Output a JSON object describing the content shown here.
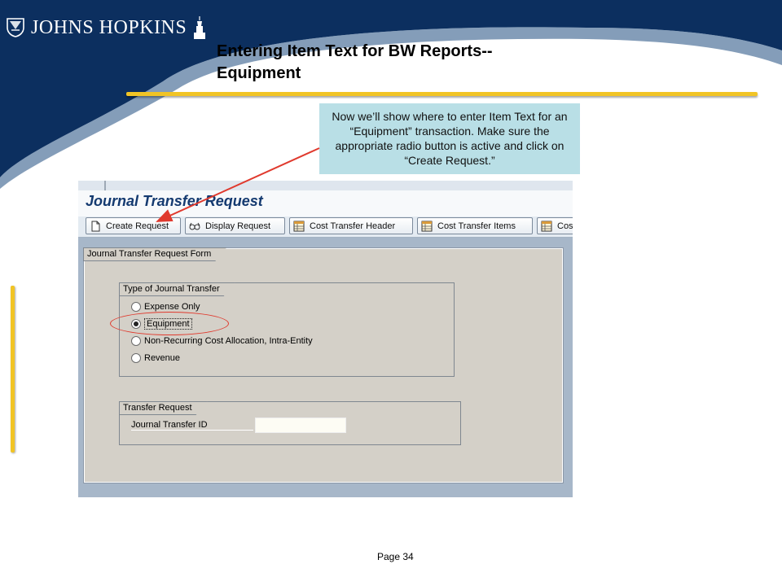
{
  "slide": {
    "logo_text": "JOHNS HOPKINS",
    "title": "Entering Item Text for BW Reports--Equipment",
    "callout": "Now we’ll show where to enter Item Text for an “Equipment” transaction. Make sure the appropriate radio button is active and click on “Create Request.”",
    "page_number": "Page 34"
  },
  "sap": {
    "screen_title": "Journal Transfer Request",
    "toolbar": [
      {
        "label": "Create Request",
        "icon": "document-icon"
      },
      {
        "label": "Display Request",
        "icon": "glasses-icon"
      },
      {
        "label": "Cost Transfer Header",
        "icon": "table-icon"
      },
      {
        "label": "Cost Transfer Items",
        "icon": "table-icon"
      },
      {
        "label": "Cos",
        "icon": "table-icon"
      }
    ],
    "form_title": "Journal Transfer Request Form",
    "type_group": {
      "title": "Type of Journal Transfer",
      "options": [
        {
          "label": "Expense Only",
          "selected": false
        },
        {
          "label": "Equipment",
          "selected": true
        },
        {
          "label": "Non-Recurring Cost Allocation, Intra-Entity",
          "selected": false
        },
        {
          "label": "Revenue",
          "selected": false
        }
      ]
    },
    "transfer_group": {
      "title": "Transfer Request",
      "field_label": "Journal Transfer ID",
      "field_value": ""
    }
  },
  "colors": {
    "navy": "#0c2f5f",
    "gold": "#f1c425",
    "callout_bg": "#b9dfe6",
    "annotation_red": "#e03a2e"
  }
}
